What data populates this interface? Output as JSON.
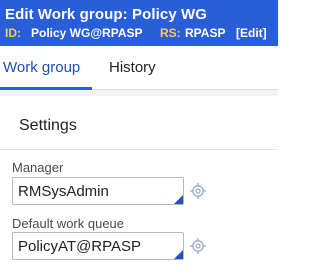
{
  "header": {
    "edit_word": "Edit",
    "title": "Work group: Policy WG",
    "id_label": "ID:",
    "id_value": "Policy WG@RPASP",
    "rs_label": "RS:",
    "rs_value": "RPASP",
    "edit_link": "[Edit]"
  },
  "tabs": [
    {
      "label": "Work group",
      "active": true
    },
    {
      "label": "History",
      "active": false
    }
  ],
  "section": {
    "title": "Settings"
  },
  "fields": {
    "manager": {
      "label": "Manager",
      "value": "RMSysAdmin",
      "icon": "target-crosshair-icon"
    },
    "default_work_queue": {
      "label": "Default work queue",
      "value": "PolicyAT@RPASP",
      "icon": "target-crosshair-icon"
    }
  },
  "colors": {
    "header_bg": "#295ed9",
    "header_label_accent": "#ffca4f",
    "tab_active": "#2d5fd4",
    "autocomplete_corner": "#1f50c9"
  }
}
